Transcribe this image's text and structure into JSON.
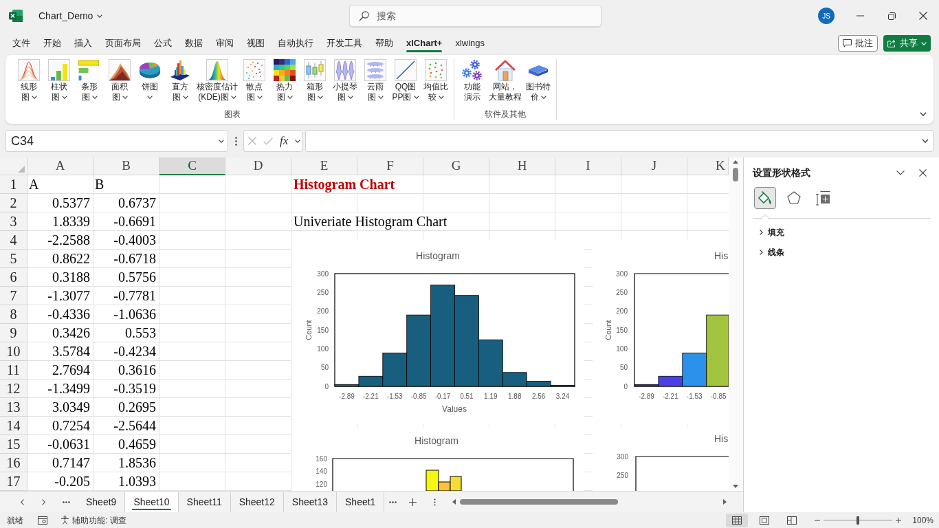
{
  "title_bar": {
    "file_name": "Chart_Demo",
    "search": {
      "placeholder": "搜索"
    },
    "user_initials": "JS"
  },
  "ribbon_tabs": [
    {
      "label": "文件",
      "selected": false
    },
    {
      "label": "开始",
      "selected": false
    },
    {
      "label": "插入",
      "selected": false
    },
    {
      "label": "页面布局",
      "selected": false
    },
    {
      "label": "公式",
      "selected": false
    },
    {
      "label": "数据",
      "selected": false
    },
    {
      "label": "审阅",
      "selected": false
    },
    {
      "label": "视图",
      "selected": false
    },
    {
      "label": "自动执行",
      "selected": false
    },
    {
      "label": "开发工具",
      "selected": false
    },
    {
      "label": "帮助",
      "selected": false
    },
    {
      "label": "xlChart+",
      "selected": true
    },
    {
      "label": "xlwings",
      "selected": false
    }
  ],
  "header_buttons": {
    "comments": "批注",
    "share": "共享"
  },
  "ribbon_groups": [
    {
      "label": "图表",
      "buttons": [
        {
          "lines": [
            "线形",
            "图"
          ],
          "has_menu": true
        },
        {
          "lines": [
            "柱状",
            "图"
          ],
          "has_menu": true
        },
        {
          "lines": [
            "条形",
            "图"
          ],
          "has_menu": true
        },
        {
          "lines": [
            "面积",
            "图"
          ],
          "has_menu": true
        },
        {
          "lines": [
            "饼图"
          ],
          "has_menu": true
        },
        {
          "lines": [
            "直方",
            "图"
          ],
          "has_menu": true
        },
        {
          "lines": [
            "核密度估计",
            "(KDE)图"
          ],
          "has_menu": true
        },
        {
          "lines": [
            "散点",
            "图"
          ],
          "has_menu": true
        },
        {
          "lines": [
            "热力",
            "图"
          ],
          "has_menu": true
        },
        {
          "lines": [
            "箱形",
            "图"
          ],
          "has_menu": true
        },
        {
          "lines": [
            "小提琴",
            "图"
          ],
          "has_menu": true
        },
        {
          "lines": [
            "云雨",
            "图"
          ],
          "has_menu": true
        },
        {
          "lines": [
            "QQ图",
            "PP图"
          ],
          "has_menu": true
        },
        {
          "lines": [
            "均值比",
            "较"
          ],
          "has_menu": true
        }
      ]
    },
    {
      "label": "软件及其他",
      "buttons": [
        {
          "lines": [
            "功能",
            "演示"
          ],
          "has_menu": false
        },
        {
          "lines": [
            "网站，",
            "大量教程"
          ],
          "has_menu": false
        },
        {
          "lines": [
            "图书特",
            "价"
          ],
          "has_menu": true
        }
      ]
    }
  ],
  "formula_bar": {
    "name_box": "C34",
    "cancel": {
      "disabled": true
    },
    "enter": {
      "disabled": true
    },
    "function_label": "fx"
  },
  "sheet": {
    "columns": [
      {
        "label": "A",
        "selected": false
      },
      {
        "label": "B",
        "selected": false
      },
      {
        "label": "C",
        "selected": true
      },
      {
        "label": "D",
        "selected": false
      },
      {
        "label": "E",
        "selected": false
      },
      {
        "label": "F",
        "selected": false
      },
      {
        "label": "G",
        "selected": false
      },
      {
        "label": "H",
        "selected": false
      },
      {
        "label": "I",
        "selected": false
      },
      {
        "label": "J",
        "selected": false
      },
      {
        "label": "K",
        "selected": false
      }
    ],
    "rows": [
      {
        "number": "1",
        "kind": "title",
        "col_a": "A",
        "col_b": "B",
        "col_e": "Histogram Chart"
      },
      {
        "number": "2",
        "kind": "data",
        "col_a": "0.5377",
        "col_b": "0.6737"
      },
      {
        "number": "3",
        "kind": "data",
        "col_a": "1.8339",
        "col_b": "-0.6691",
        "col_e": "Univeriate Histogram Chart"
      },
      {
        "number": "4",
        "kind": "data",
        "col_a": "-2.2588",
        "col_b": "-0.4003"
      },
      {
        "number": "5",
        "kind": "data",
        "col_a": "0.8622",
        "col_b": "-0.6718"
      },
      {
        "number": "6",
        "kind": "data",
        "col_a": "0.3188",
        "col_b": "0.5756"
      },
      {
        "number": "7",
        "kind": "data",
        "col_a": "-1.3077",
        "col_b": "-0.7781"
      },
      {
        "number": "8",
        "kind": "data",
        "col_a": "-0.4336",
        "col_b": "-1.0636"
      },
      {
        "number": "9",
        "kind": "data",
        "col_a": "0.3426",
        "col_b": "0.553"
      },
      {
        "number": "10",
        "kind": "data",
        "col_a": "3.5784",
        "col_b": "-0.4234"
      },
      {
        "number": "11",
        "kind": "data",
        "col_a": "2.7694",
        "col_b": "0.3616"
      },
      {
        "number": "12",
        "kind": "data",
        "col_a": "-1.3499",
        "col_b": "-0.3519"
      },
      {
        "number": "13",
        "kind": "data",
        "col_a": "3.0349",
        "col_b": "0.2695"
      },
      {
        "number": "14",
        "kind": "data",
        "col_a": "0.7254",
        "col_b": "-2.5644"
      },
      {
        "number": "15",
        "kind": "data",
        "col_a": "-0.0631",
        "col_b": "0.4659"
      },
      {
        "number": "16",
        "kind": "data",
        "col_a": "0.7147",
        "col_b": "1.8536"
      },
      {
        "number": "17",
        "kind": "data",
        "col_a": "-0.205",
        "col_b": "1.0393"
      }
    ]
  },
  "charts": [
    {
      "chart_data": {
        "type": "bar",
        "title": "Histogram",
        "xlabel": "Values",
        "ylabel": "Count",
        "categories": [
          "-2.89",
          "-2.21",
          "-1.53",
          "-0.85",
          "-0.17",
          "0.51",
          "1.19",
          "1.88",
          "2.56",
          "3.24"
        ],
        "series": [
          {
            "color": "#175e7f",
            "values": [
              5,
              27,
              89,
              190,
              270,
              242,
              124,
              37,
              14,
              3
            ]
          }
        ],
        "ylim": [
          0,
          300
        ],
        "yticks": [
          0,
          50,
          100,
          150,
          200,
          250,
          300
        ]
      }
    },
    {
      "chart_data": {
        "type": "bar",
        "title": "His",
        "ylabel": "Count",
        "categories": [
          "-2.89",
          "-2.21",
          "-1.53",
          "-0.85"
        ],
        "series": [
          {
            "color": "#3b22a2",
            "values": [
              5,
              null,
              null,
              null
            ]
          },
          {
            "color": "#4a3fe2",
            "values": [
              null,
              27,
              null,
              null
            ]
          },
          {
            "color": "#2b91ea",
            "values": [
              null,
              null,
              89,
              null
            ]
          },
          {
            "color": "#a2c43e",
            "values": [
              null,
              null,
              null,
              190
            ]
          }
        ],
        "stacked": true,
        "ylim": [
          0,
          300
        ],
        "yticks": [
          0,
          50,
          100,
          150,
          200,
          250,
          300
        ]
      }
    }
  ],
  "lower_charts": [
    {
      "title": "Histogram",
      "ytick_labels": [
        "160",
        "140",
        "120"
      ]
    },
    {
      "title": "His",
      "ytick_labels": [
        "300",
        "250"
      ]
    }
  ],
  "format_pane": {
    "title": "设置形状格式",
    "tabs": [
      {
        "selected": true
      },
      {
        "selected": false
      },
      {
        "selected": false
      }
    ],
    "sections": [
      {
        "label": "填充",
        "expanded": false
      },
      {
        "label": "线条",
        "expanded": false
      }
    ]
  },
  "sheet_tabs": [
    {
      "label": "Sheet9",
      "selected": false
    },
    {
      "label": "Sheet10",
      "selected": true
    },
    {
      "label": "Sheet11",
      "selected": false
    },
    {
      "label": "Sheet12",
      "selected": false
    },
    {
      "label": "Sheet13",
      "selected": false
    },
    {
      "label": "Sheet1",
      "selected": false
    }
  ],
  "status_bar": {
    "status": "就绪",
    "accessibility": "辅助功能: 调查",
    "views": [
      {
        "selected": true
      },
      {
        "selected": false
      },
      {
        "selected": false
      }
    ],
    "zoom_slider": {
      "level": 0.5
    },
    "zoom": "100%"
  }
}
